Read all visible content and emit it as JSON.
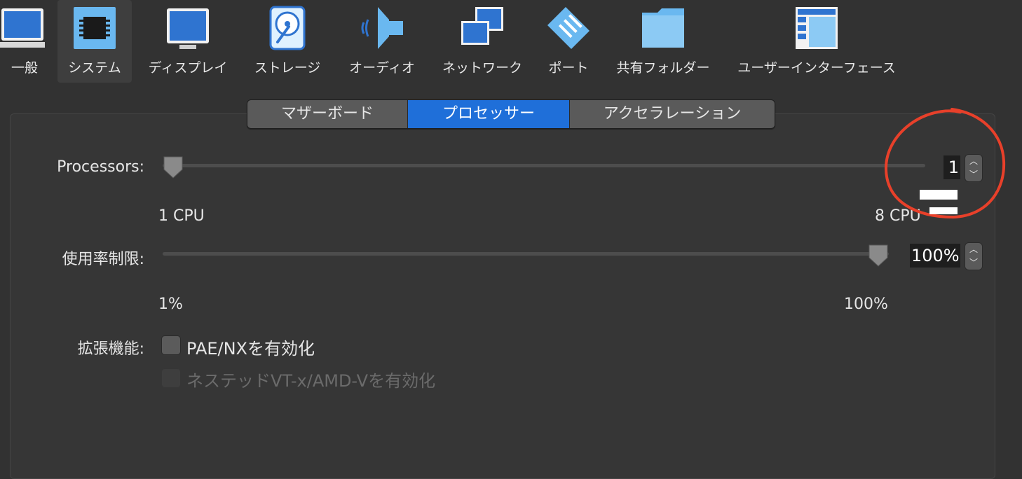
{
  "toolbar": {
    "items": [
      {
        "label": "一般",
        "icon": "monitor-icon"
      },
      {
        "label": "システム",
        "icon": "chip-icon",
        "selected": true
      },
      {
        "label": "ディスプレイ",
        "icon": "display-icon"
      },
      {
        "label": "ストレージ",
        "icon": "disk-icon"
      },
      {
        "label": "オーディオ",
        "icon": "speaker-icon"
      },
      {
        "label": "ネットワーク",
        "icon": "network-icon"
      },
      {
        "label": "ポート",
        "icon": "port-icon"
      },
      {
        "label": "共有フォルダー",
        "icon": "folder-icon"
      },
      {
        "label": "ユーザーインターフェース",
        "icon": "ui-window-icon"
      }
    ]
  },
  "tabs": [
    {
      "label": "マザーボード"
    },
    {
      "label": "プロセッサー",
      "active": true
    },
    {
      "label": "アクセラレーション"
    }
  ],
  "processors": {
    "label": "Processors:",
    "min_label": "1 CPU",
    "max_label": "8 CPU",
    "value": "1",
    "level": 0.0
  },
  "usage_limit": {
    "label": "使用率制限:",
    "min_label": "1%",
    "max_label": "100%",
    "value": "100%",
    "level": 1.0
  },
  "extended": {
    "label": "拡張機能:",
    "pae_label": "PAE/NXを有効化",
    "nested_label": "ネステッドVT-x/AMD-Vを有効化"
  },
  "colors": {
    "accent": "#1f6fd9",
    "annotation": "#e8402a"
  }
}
